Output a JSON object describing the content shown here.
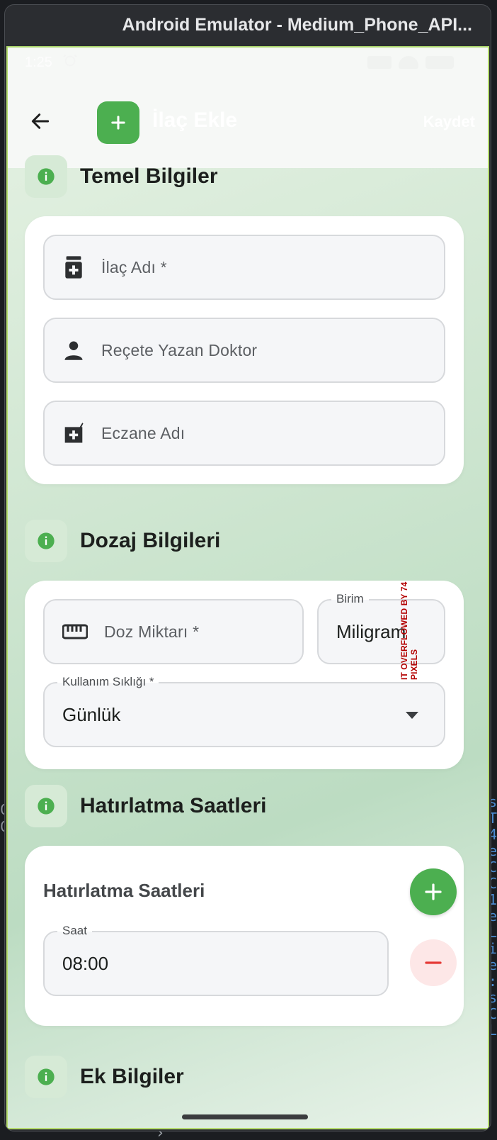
{
  "emulator": {
    "window_title": "Android Emulator - Medium_Phone_API..."
  },
  "status_bar": {
    "time": "1:25"
  },
  "app_bar": {
    "title": "İlaç Ekle",
    "save_label": "Kaydet"
  },
  "sections": {
    "basic": {
      "title": "Temel Bilgiler",
      "fields": {
        "drug_name_placeholder": "İlaç Adı *",
        "doctor_placeholder": "Reçete Yazan Doktor",
        "pharmacy_placeholder": "Eczane Adı"
      }
    },
    "dosage": {
      "title": "Dozaj Bilgileri",
      "dose_placeholder": "Doz Miktarı *",
      "unit_label": "Birim",
      "unit_value": "Miligram",
      "overflow_warning": "IT OVERFLOWED BY 74 PIXELS",
      "frequency_label": "Kullanım Sıklığı *",
      "frequency_value": "Günlük"
    },
    "reminders": {
      "title": "Hatırlatma Saatleri",
      "card_label": "Hatırlatma Saatleri",
      "time_label": "Saat",
      "time_value": "08:00"
    },
    "extra": {
      "title": "Ek Bilgiler"
    }
  },
  "background": {
    "code_chars": "s\nT\n4\ne\nC\nC\n1\ne\nL\ni\ne\n:\ns\nC\nL",
    "left_chars": "C\nC"
  },
  "colors": {
    "accent_green": "#4caf50",
    "remove_bg": "#fde7e7",
    "remove_fg": "#e53935",
    "overflow_red": "#b30000"
  },
  "icons": {
    "back": "arrow-left-icon",
    "appbar": "plus-icon",
    "section": "info-icon",
    "drug": "medication-icon",
    "doctor": "person-icon",
    "pharmacy": "pharmacy-icon",
    "dose": "ruler-icon",
    "dropdown": "chevron-down-icon",
    "add": "plus-icon",
    "remove": "minus-icon"
  }
}
